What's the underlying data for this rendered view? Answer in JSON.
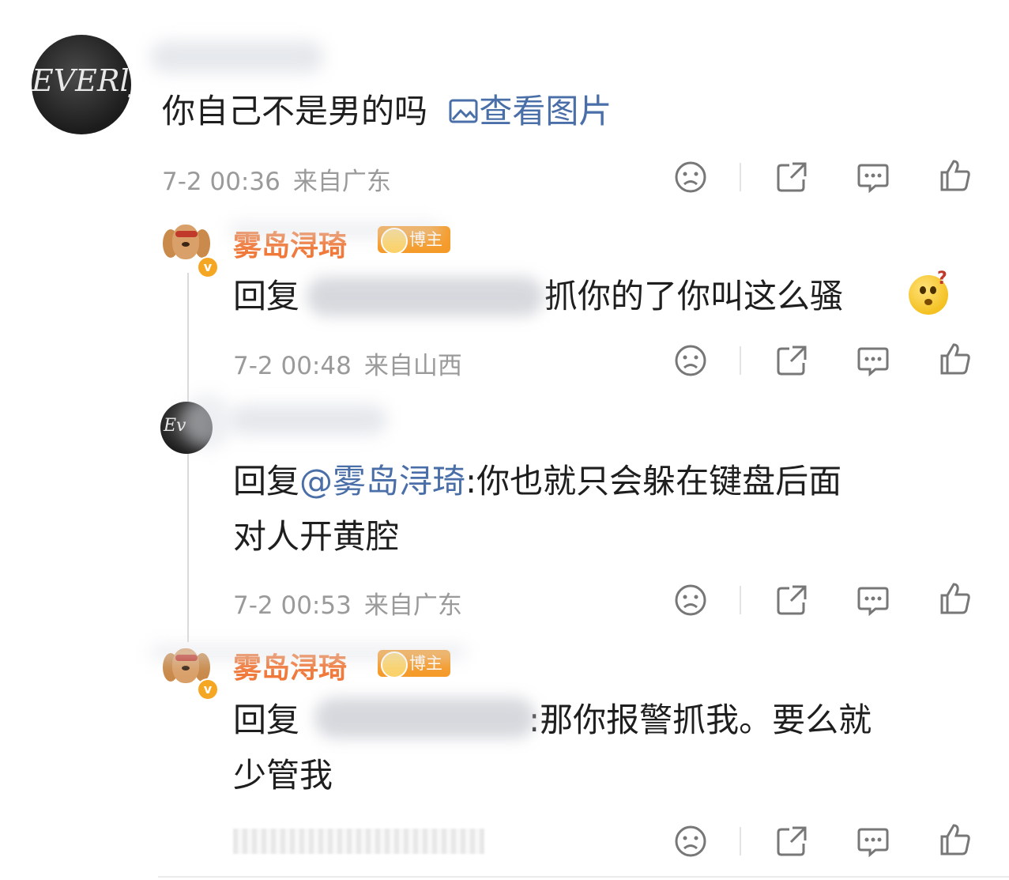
{
  "comments": [
    {
      "text": "你自己不是男的吗",
      "view_image_label": "查看图片",
      "time": "7-2 00:36",
      "location": "来自广东"
    },
    {
      "name": "雾岛浔琦",
      "badge": "博主",
      "reply_prefix": "回复",
      "text": "抓你的了你叫这么骚",
      "time": "7-2 00:48",
      "location": "来自山西"
    },
    {
      "reply_prefix": "回复",
      "mention": "@雾岛浔琦",
      "text_line1": ":你也就只会躲在键盘后面",
      "text_line2": "对人开黄腔",
      "time": "7-2 00:53",
      "location": "来自广东"
    },
    {
      "name": "雾岛浔琦",
      "badge": "博主",
      "reply_prefix": "回复",
      "text_line1": ":那你报警抓我。要么就",
      "text_line2": "少管我"
    }
  ],
  "avatar_script": "EVERly",
  "avatar_script_short": "Ev",
  "vip_mark": "v",
  "icons": [
    "dislike-icon",
    "share-icon",
    "comment-icon",
    "like-icon"
  ]
}
